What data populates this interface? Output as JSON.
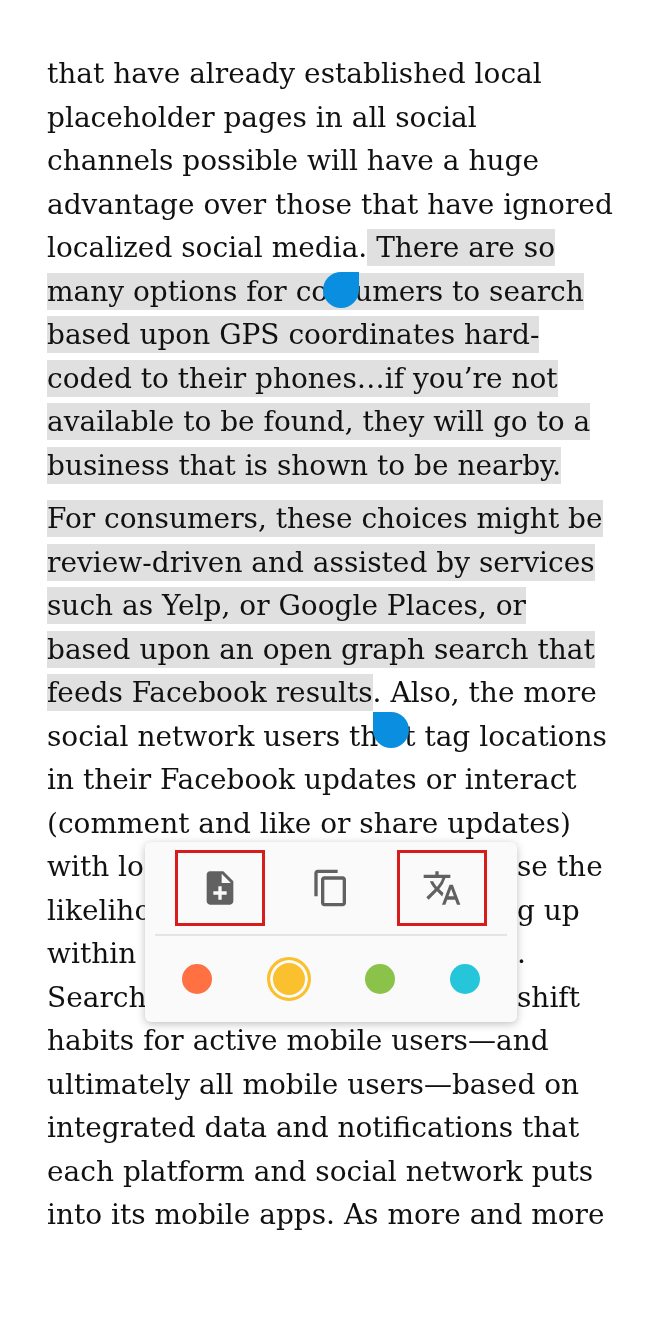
{
  "paragraphs": [
    {
      "lines": [
        {
          "segments": [
            {
              "text": "that have already established local",
              "highlighted": false
            }
          ]
        },
        {
          "segments": [
            {
              "text": "placeholder pages in all social",
              "highlighted": false
            }
          ]
        },
        {
          "segments": [
            {
              "text": "channels possible will have a huge",
              "highlighted": false
            }
          ]
        },
        {
          "segments": [
            {
              "text": "advantage over those that have ignored",
              "highlighted": false
            }
          ]
        },
        {
          "segments": [
            {
              "text": "localized social media.",
              "highlighted": false
            },
            {
              "text": " There are so",
              "highlighted": true
            }
          ]
        },
        {
          "segments": [
            {
              "text": "many options for co",
              "highlighted": true
            }
          ],
          "handle": {
            "kind": "start"
          },
          "after_handle": [
            {
              "text": "umers to search",
              "highlighted": true
            }
          ]
        },
        {
          "segments": [
            {
              "text": "based upon GPS coordinates hard-",
              "highlighted": true
            }
          ]
        },
        {
          "segments": [
            {
              "text": "coded to their phones…if you’re not",
              "highlighted": true
            }
          ]
        },
        {
          "segments": [
            {
              "text": "available to be found, they will go to a",
              "highlighted": true
            }
          ]
        },
        {
          "segments": [
            {
              "text": "business that is shown to be nearby.",
              "highlighted": true
            }
          ]
        }
      ]
    },
    {
      "lines": [
        {
          "segments": [
            {
              "text": "For consumers, these choices might be",
              "highlighted": true
            }
          ]
        },
        {
          "segments": [
            {
              "text": "review-driven and assisted by services",
              "highlighted": true
            }
          ]
        },
        {
          "segments": [
            {
              "text": "such as Yelp, or Google Places, or",
              "highlighted": true
            }
          ]
        },
        {
          "segments": [
            {
              "text": "based upon an open graph search that",
              "highlighted": true
            }
          ]
        },
        {
          "segments": [
            {
              "text": "feeds Facebook results",
              "highlighted": true
            },
            {
              "text": ". Also, the more",
              "highlighted": false
            }
          ]
        },
        {
          "segments": [
            {
              "text": "social network users th",
              "highlighted": false
            }
          ],
          "handle": {
            "kind": "end"
          },
          "after_handle": [
            {
              "text": "t tag locations",
              "highlighted": false
            }
          ]
        },
        {
          "segments": [
            {
              "text": "in their Facebook updates or interact",
              "highlighted": false
            }
          ]
        },
        {
          "segments": [
            {
              "text": "(comment and like or share updates)",
              "highlighted": false
            }
          ]
        },
        {
          "segments": [
            {
              "text": "with lo",
              "highlighted": false
            }
          ],
          "after_popup": [
            {
              "text": "se the",
              "highlighted": false
            }
          ]
        },
        {
          "segments": [
            {
              "text": "likeliho",
              "highlighted": false
            }
          ],
          "after_popup": [
            {
              "text": "g up",
              "highlighted": false
            }
          ]
        },
        {
          "segments": [
            {
              "text": "within",
              "highlighted": false
            }
          ],
          "after_popup": [
            {
              "text": ".",
              "highlighted": false
            }
          ]
        },
        {
          "segments": [
            {
              "text": "Search",
              "highlighted": false
            }
          ],
          "after_popup": [
            {
              "text": "shift",
              "highlighted": false
            }
          ]
        },
        {
          "segments": [
            {
              "text": "habits for active mobile users—and",
              "highlighted": false
            }
          ]
        },
        {
          "segments": [
            {
              "text": "ultimately all mobile users—based on",
              "highlighted": false
            }
          ]
        },
        {
          "segments": [
            {
              "text": "integrated data and notifications that",
              "highlighted": false
            }
          ]
        },
        {
          "segments": [
            {
              "text": "each platform and social network puts",
              "highlighted": false
            }
          ]
        },
        {
          "segments": [
            {
              "text": "into its mobile apps. As more and more",
              "highlighted": false
            }
          ]
        }
      ]
    }
  ],
  "popup": {
    "actions": [
      {
        "kind": "note",
        "outlined": true
      },
      {
        "kind": "copy",
        "outlined": false
      },
      {
        "kind": "translate",
        "outlined": true
      }
    ],
    "colors": [
      {
        "color": "#ff7043",
        "selected": false
      },
      {
        "color": "#fbc02d",
        "selected": true
      },
      {
        "color": "#8bc34a",
        "selected": false
      },
      {
        "color": "#26c6da",
        "selected": false
      }
    ]
  }
}
